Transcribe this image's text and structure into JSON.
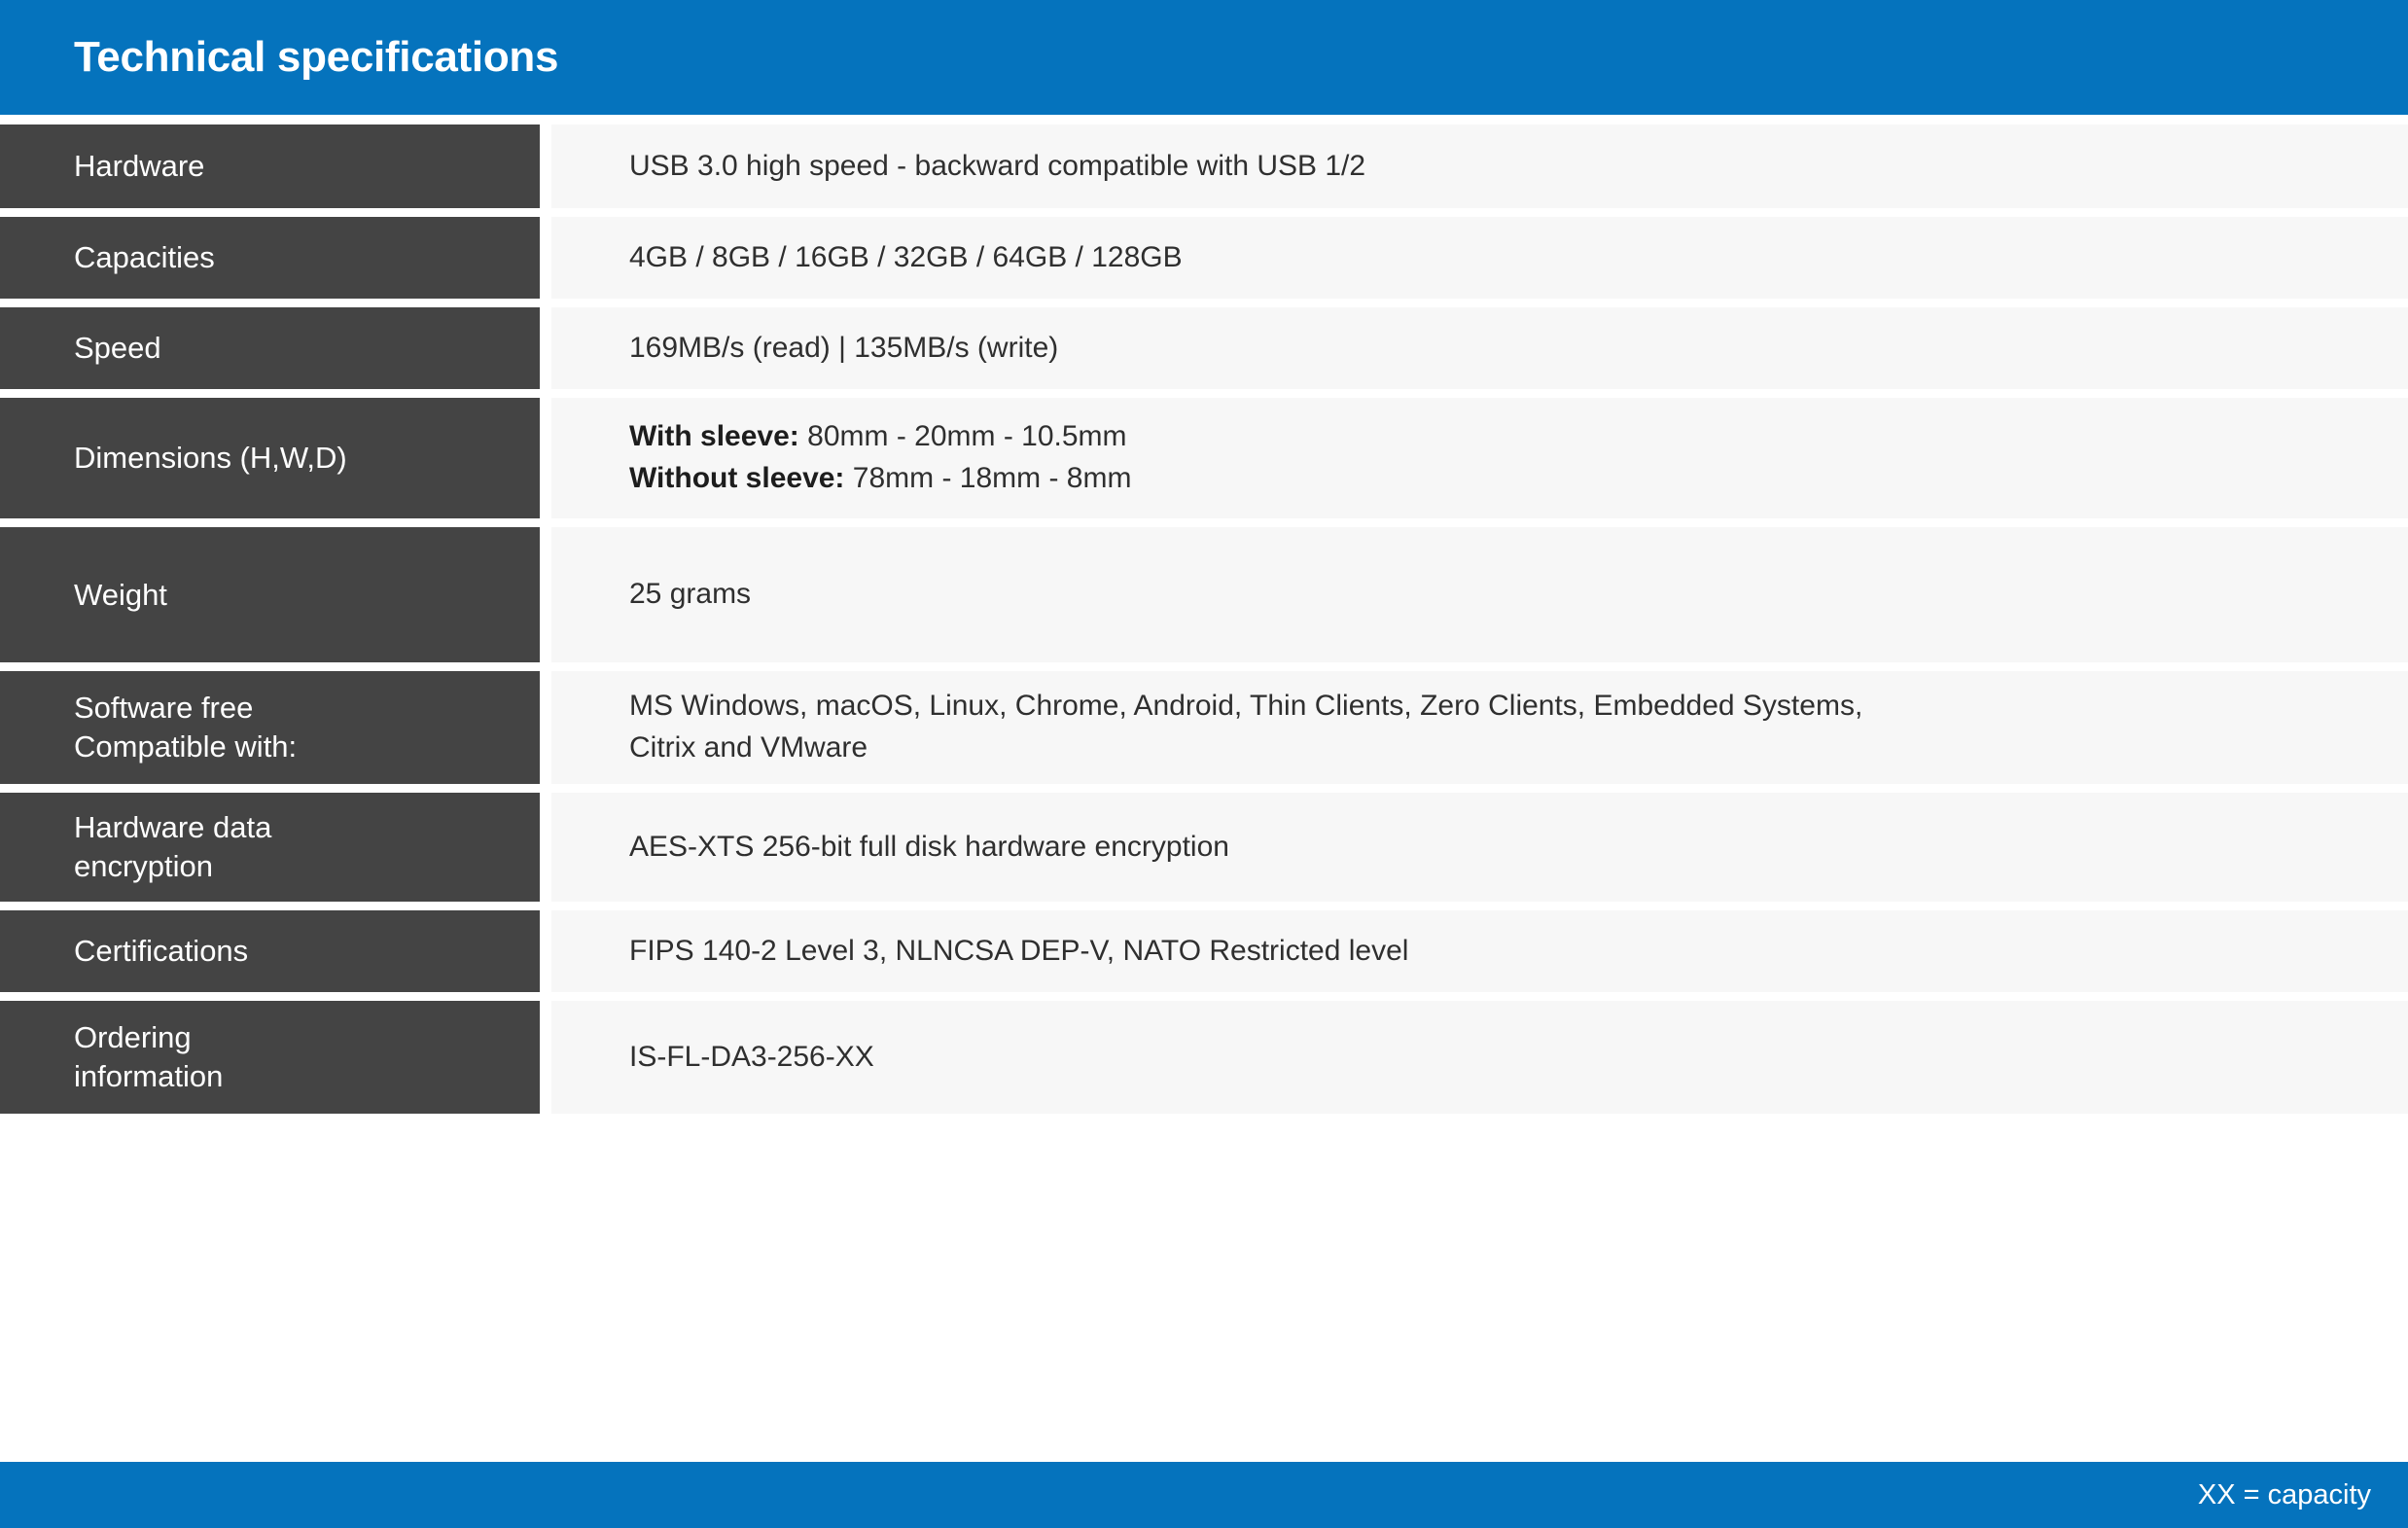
{
  "header": {
    "title": "Technical specifications",
    "background_color": "#0573bd",
    "text_color": "#ffffff"
  },
  "theme": {
    "accent_blue": "#0573bd",
    "label_cell_background": "#444444",
    "value_cell_background": "#f7f7f7",
    "value_text_color": "#2f2f2f",
    "page_background": "#ffffff"
  },
  "spec_table": {
    "rows": [
      {
        "label": "Hardware",
        "value": "USB 3.0 high speed - backward compatible with USB 1/2"
      },
      {
        "label": "Capacities",
        "value": "4GB / 8GB / 16GB / 32GB / 64GB / 128GB"
      },
      {
        "label": "Speed",
        "value": "169MB/s (read)  |  135MB/s (write)"
      },
      {
        "label": "Dimensions (H,W,D)",
        "value_line1_bold": "With sleeve:",
        "value_line1_rest": " 80mm - 20mm - 10.5mm",
        "value_line2_bold": "Without sleeve:",
        "value_line2_rest": " 78mm - 18mm - 8mm"
      },
      {
        "label": "Weight",
        "value": "25 grams"
      },
      {
        "label": "Software free\nCompatible with:",
        "value": "MS Windows, macOS, Linux, Chrome, Android, Thin Clients, Zero Clients, Embedded Systems,\nCitrix and VMware"
      },
      {
        "label": "Hardware data\nencryption",
        "value": "AES-XTS 256-bit full disk hardware encryption"
      },
      {
        "label": "Certifications",
        "value": "FIPS 140-2 Level 3, NLNCSA DEP-V, NATO Restricted level"
      },
      {
        "label": "Ordering\ninformation",
        "value": "IS-FL-DA3-256-XX"
      }
    ]
  },
  "footer": {
    "note": "XX = capacity",
    "background_color": "#0573bd"
  }
}
